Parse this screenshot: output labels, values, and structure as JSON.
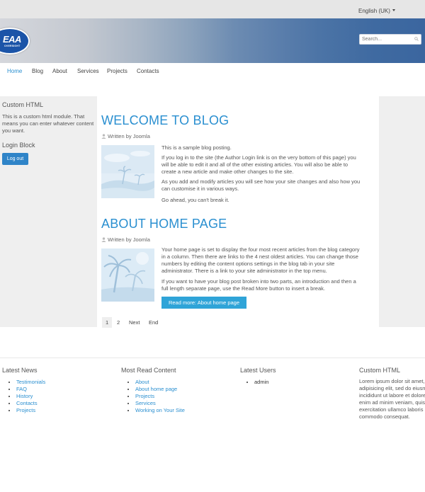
{
  "topbar": {
    "language": "English (UK)"
  },
  "header": {
    "logo_text": "EAA",
    "logo_sub": "OVERSIGHT",
    "search_placeholder": "Search..."
  },
  "nav": {
    "items": [
      "Home",
      "Blog",
      "About",
      "Services",
      "Projects",
      "Contacts"
    ]
  },
  "sidebar": {
    "custom_html_title": "Custom HTML",
    "custom_html_text": "This is a custom html module. That means you can enter whatever content you want.",
    "login_title": "Login Block",
    "logout_label": "Log out"
  },
  "articles": [
    {
      "title": "WELCOME TO BLOG",
      "author": "Written by Joomla",
      "paragraphs": [
        "This is a sample blog posting.",
        "If you log in to the site (the Author Login link is on the very bottom of this page) you will be able to edit it and all of the other existing articles. You will also be able to create a new article and make other changes to the site.",
        "As you add and modify articles you will see how your site changes and also how you can customise it in various ways.",
        "Go ahead, you can't break it."
      ]
    },
    {
      "title": "ABOUT HOME PAGE",
      "author": "Written by Joomla",
      "paragraphs": [
        "Your home page is set to display the four most recent articles from the blog category in a column. Then there are links to the 4 nest oldest articles. You can change those numbers by editing the content options settings in the blog tab in your site administrator. There is a link to your site administrator in the top menu.",
        "If you want to have your blog post broken into two parts, an introduction and then a full length separate page, use the Read More button to insert a break."
      ],
      "read_more": "Read more: About home page"
    }
  ],
  "pagination": [
    "1",
    "2",
    "Next",
    "End"
  ],
  "footer": {
    "latest_news": {
      "title": "Latest News",
      "items": [
        "Testimonials",
        "FAQ",
        "History",
        "Contacts",
        "Projects"
      ]
    },
    "most_read": {
      "title": "Most Read Content",
      "items": [
        "About",
        "About home page",
        "Projects",
        "Services",
        "Working on Your Site"
      ]
    },
    "latest_users": {
      "title": "Latest Users",
      "items": [
        "admin"
      ]
    },
    "custom_html": {
      "title": "Custom HTML",
      "lines": [
        "Lorem ipsum dolor sit amet,",
        "adipisicing elit, sed do eiusm",
        "incididunt ut labore et dolore",
        "enim ad minim veniam, quis",
        "exercitation ullamco laboris",
        "commodo consequat."
      ]
    }
  },
  "colors": {
    "accent": "#2a8fd0",
    "button": "#2fa4d8",
    "logout": "#2f84c8",
    "sidebar_bg": "#efefef"
  }
}
